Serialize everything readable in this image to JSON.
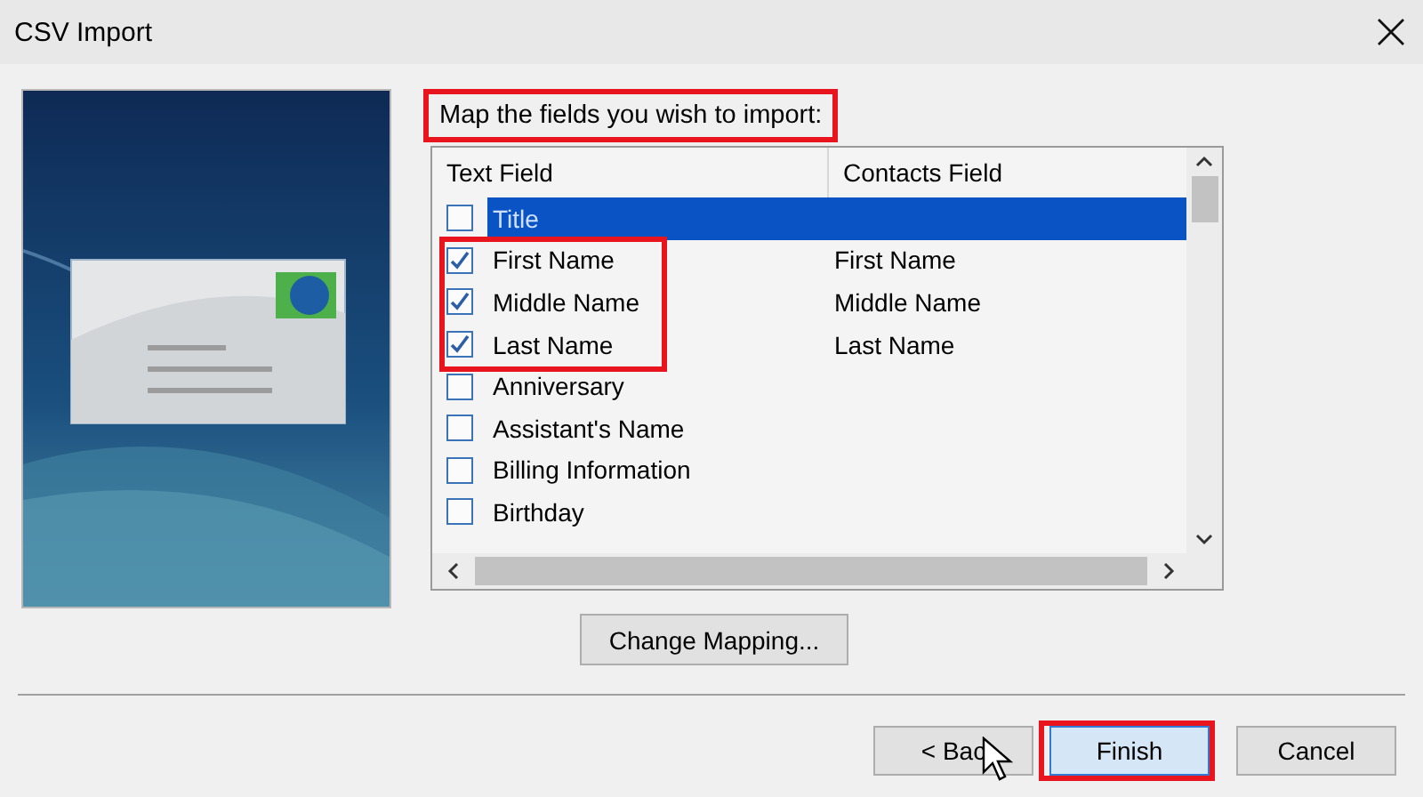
{
  "window": {
    "title": "CSV Import"
  },
  "instruction": {
    "text": "Map the fields you wish to import:",
    "highlighted": true
  },
  "table": {
    "columns": [
      "Text Field",
      "Contacts Field"
    ],
    "rows": [
      {
        "text_field": "Title",
        "checked": false,
        "selected": true,
        "highlighted": false
      },
      {
        "text_field": "First Name",
        "contacts_field": "First Name",
        "checked": true,
        "selected": false,
        "highlighted": true
      },
      {
        "text_field": "Middle Name",
        "contacts_field": "Middle Name",
        "checked": true,
        "selected": false,
        "highlighted": true
      },
      {
        "text_field": "Last Name",
        "contacts_field": "Last Name",
        "checked": true,
        "selected": false,
        "highlighted": true
      },
      {
        "text_field": "Anniversary",
        "checked": false,
        "selected": false,
        "highlighted": false
      },
      {
        "text_field": "Assistant's Name",
        "checked": false,
        "selected": false,
        "highlighted": false
      },
      {
        "text_field": "Billing Information",
        "checked": false,
        "selected": false,
        "highlighted": false
      },
      {
        "text_field": "Birthday",
        "checked": false,
        "selected": false,
        "highlighted": false
      }
    ]
  },
  "change_mapping_button": {
    "label": "Change Mapping..."
  },
  "footer_buttons": [
    {
      "label": "< Bac",
      "default": false,
      "highlighted": false
    },
    {
      "label": "Finish",
      "default": true,
      "highlighted": true
    },
    {
      "label": "Cancel",
      "default": false,
      "highlighted": false
    }
  ]
}
